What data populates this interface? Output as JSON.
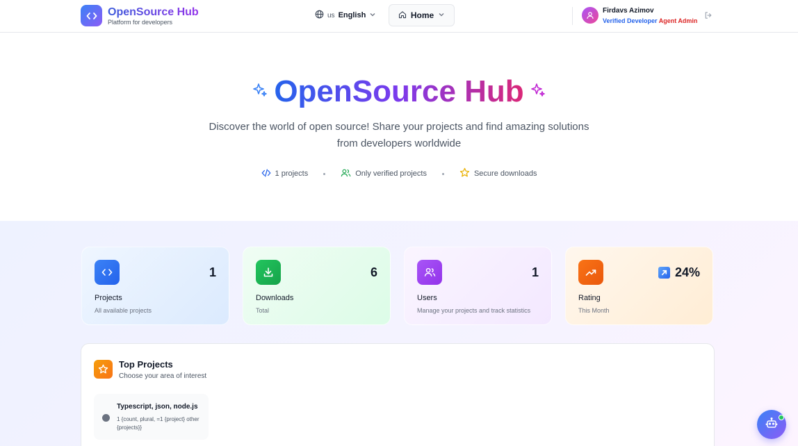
{
  "header": {
    "brand_title": "OpenSource Hub",
    "brand_subtitle": "Platform for developers",
    "lang_code": "us",
    "lang_label": "English",
    "home_label": "Home",
    "user_name": "Firdavs Azimov",
    "role_verified": "Verified Developer",
    "role_admin": "Agent Admin"
  },
  "hero": {
    "title": "OpenSource Hub",
    "description": "Discover the world of open source! Share your projects and find amazing solutions from developers worldwide",
    "features": {
      "projects": "1 projects",
      "verified": "Only verified projects",
      "secure": "Secure downloads"
    }
  },
  "stats": {
    "projects": {
      "value": "1",
      "label": "Projects",
      "sub": "All available projects"
    },
    "downloads": {
      "value": "6",
      "label": "Downloads",
      "sub": "Total"
    },
    "users": {
      "value": "1",
      "label": "Users",
      "sub": "Manage your projects and track statistics"
    },
    "rating": {
      "value": "24%",
      "label": "Rating",
      "sub": "This Month"
    }
  },
  "top_projects": {
    "title": "Top Projects",
    "subtitle": "Choose your area of interest",
    "tags": [
      {
        "name": "Typescript, json, node.js",
        "count": "1 {count, plural, =1 {project} other {projects}}"
      }
    ]
  },
  "colors": {
    "primary": "#3b82f6",
    "accent": "#8b5cf6",
    "pink": "#db2777"
  }
}
